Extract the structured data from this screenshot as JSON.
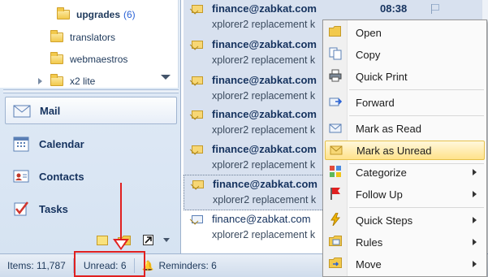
{
  "folders": [
    {
      "name": "upgrades",
      "count": "(6)"
    },
    {
      "name": "translators"
    },
    {
      "name": "webmaestros"
    },
    {
      "name": "x2 lite"
    }
  ],
  "nav": {
    "mail": "Mail",
    "calendar": "Calendar",
    "contacts": "Contacts",
    "tasks": "Tasks"
  },
  "messages": [
    {
      "from": "finance@zabkat.com",
      "subject": "xplorer2 replacement k",
      "time": "08:38"
    },
    {
      "from": "finance@zabkat.com",
      "subject": "xplorer2 replacement k"
    },
    {
      "from": "finance@zabkat.com",
      "subject": "xplorer2 replacement k"
    },
    {
      "from": "finance@zabkat.com",
      "subject": "xplorer2 replacement k"
    },
    {
      "from": "finance@zabkat.com",
      "subject": "xplorer2 replacement k"
    },
    {
      "from": "finance@zabkat.com",
      "subject": "xplorer2 replacement k"
    },
    {
      "from": "finance@zabkat.com",
      "subject": "xplorer2 replacement k"
    }
  ],
  "context_menu": [
    {
      "label": "Open",
      "icon": "open-folder-icon"
    },
    {
      "label": "Copy",
      "icon": "copy-icon"
    },
    {
      "label": "Quick Print",
      "icon": "printer-icon"
    },
    {
      "label": "Forward",
      "icon": "forward-icon"
    },
    {
      "label": "Mark as Read",
      "icon": "read-envelope-icon"
    },
    {
      "label": "Mark as Unread",
      "icon": "unread-envelope-icon"
    },
    {
      "label": "Categorize",
      "icon": "categorize-icon"
    },
    {
      "label": "Follow Up",
      "icon": "flag-icon"
    },
    {
      "label": "Quick Steps",
      "icon": "lightning-icon"
    },
    {
      "label": "Rules",
      "icon": "rules-icon"
    },
    {
      "label": "Move",
      "icon": "move-icon"
    }
  ],
  "status": {
    "items": "Items: 11,787",
    "unread": "Unread: 6",
    "reminders": "Reminders: 6"
  },
  "colors": {
    "annotation": "#e02020",
    "highlight": "#ffe28a"
  }
}
